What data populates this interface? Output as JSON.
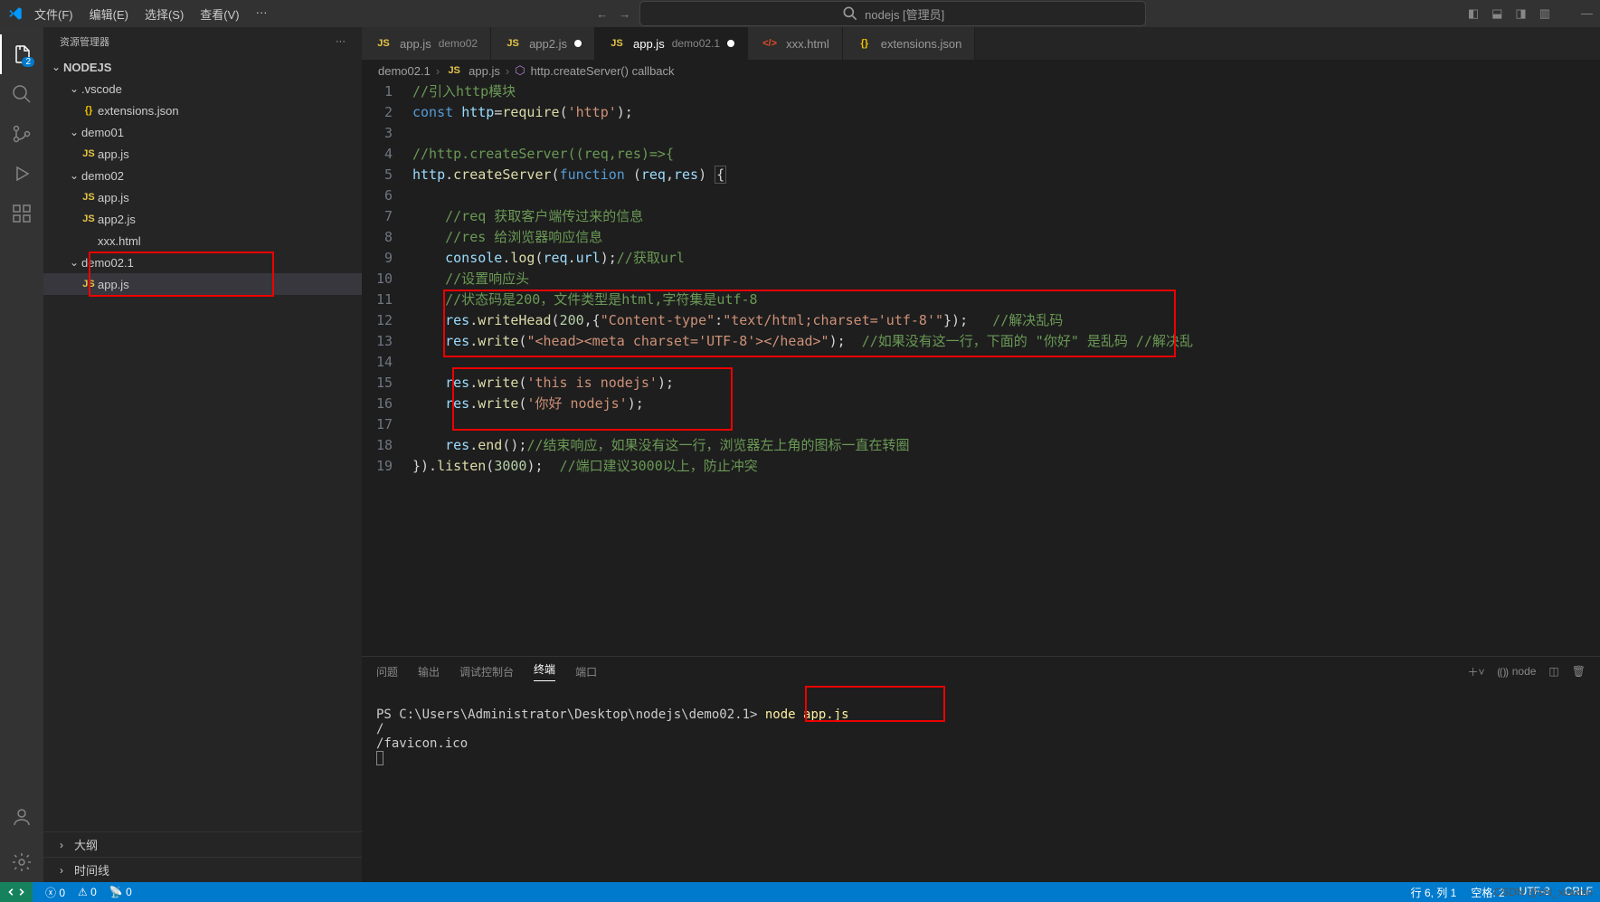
{
  "menu": [
    "文件(F)",
    "编辑(E)",
    "选择(S)",
    "查看(V)",
    "···"
  ],
  "window_title": "nodejs [管理员]",
  "activity_badge": "2",
  "explorer": {
    "title": "资源管理器",
    "root": "NODEJS",
    "items": [
      {
        "kind": "folder",
        "name": ".vscode",
        "depth": 1,
        "open": true
      },
      {
        "kind": "file",
        "name": "extensions.json",
        "depth": 2,
        "icon": "json"
      },
      {
        "kind": "folder",
        "name": "demo01",
        "depth": 1,
        "open": true
      },
      {
        "kind": "file",
        "name": "app.js",
        "depth": 2,
        "icon": "js"
      },
      {
        "kind": "folder",
        "name": "demo02",
        "depth": 1,
        "open": true
      },
      {
        "kind": "file",
        "name": "app.js",
        "depth": 2,
        "icon": "js"
      },
      {
        "kind": "file",
        "name": "app2.js",
        "depth": 2,
        "icon": "js"
      },
      {
        "kind": "file",
        "name": "xxx.html",
        "depth": 2,
        "icon": "html"
      },
      {
        "kind": "folder",
        "name": "demo02.1",
        "depth": 1,
        "open": true,
        "hl": true
      },
      {
        "kind": "file",
        "name": "app.js",
        "depth": 2,
        "icon": "js",
        "selected": true,
        "hl": true
      }
    ],
    "outline": "大纲",
    "timeline": "时间线"
  },
  "tabs": [
    {
      "icon": "js",
      "name": "app.js",
      "suffix": "demo02"
    },
    {
      "icon": "js",
      "name": "app2.js",
      "dirty": true
    },
    {
      "icon": "js",
      "name": "app.js",
      "suffix": "demo02.1",
      "active": true,
      "dirty": true
    },
    {
      "icon": "html",
      "name": "xxx.html"
    },
    {
      "icon": "json",
      "name": "extensions.json"
    }
  ],
  "breadcrumb": {
    "folder": "demo02.1",
    "file": "app.js",
    "symbol": "http.createServer() callback"
  },
  "code_lines": [
    {
      "n": 1,
      "html": "<span class='tok-comment'>//引入http模块</span>"
    },
    {
      "n": 2,
      "html": "<span class='tok-keyword'>const</span> <span class='tok-var'>http</span>=<span class='tok-func'>require</span>(<span class='tok-string'>'http'</span>);"
    },
    {
      "n": 3,
      "html": ""
    },
    {
      "n": 4,
      "html": "<span class='tok-comment'>//http.createServer((req,res)=&gt;{</span>"
    },
    {
      "n": 5,
      "html": "<span class='tok-var'>http</span>.<span class='tok-func'>createServer</span>(<span class='tok-keyword'>function</span> (<span class='tok-var'>req</span>,<span class='tok-var'>res</span>) <span style='border:1px solid #555;padding:0 1px'>{</span>"
    },
    {
      "n": 6,
      "html": ""
    },
    {
      "n": 7,
      "html": "    <span class='tok-comment'>//req 获取客户端传过来的信息</span>"
    },
    {
      "n": 8,
      "html": "    <span class='tok-comment'>//res 给浏览器响应信息</span>"
    },
    {
      "n": 9,
      "html": "    <span class='tok-var'>console</span>.<span class='tok-func'>log</span>(<span class='tok-var'>req</span>.<span class='tok-var'>url</span>);<span class='tok-comment'>//获取url</span>"
    },
    {
      "n": 10,
      "html": "    <span class='tok-comment'>//设置响应头</span>"
    },
    {
      "n": 11,
      "html": "    <span class='tok-comment'>//状态码是200，文件类型是html,字符集是utf-8</span>"
    },
    {
      "n": 12,
      "html": "    <span class='tok-var'>res</span>.<span class='tok-func'>writeHead</span>(<span class='tok-num'>200</span>,{<span class='tok-string'>\"Content-type\"</span>:<span class='tok-string'>\"text/html;charset='utf-8'\"</span>});   <span class='tok-comment'>//解决乱码</span>"
    },
    {
      "n": 13,
      "html": "    <span class='tok-var'>res</span>.<span class='tok-func'>write</span>(<span class='tok-string'>\"&lt;head&gt;&lt;meta charset='UTF-8'&gt;&lt;/head&gt;\"</span>);  <span class='tok-comment'>//如果没有这一行，下面的 \"你好\" 是乱码 //解决乱</span>"
    },
    {
      "n": 14,
      "html": ""
    },
    {
      "n": 15,
      "html": "    <span class='tok-var'>res</span>.<span class='tok-func'>write</span>(<span class='tok-string'>'this is nodejs'</span>);"
    },
    {
      "n": 16,
      "html": "    <span class='tok-var'>res</span>.<span class='tok-func'>write</span>(<span class='tok-string'>'你好 nodejs'</span>);"
    },
    {
      "n": 17,
      "html": ""
    },
    {
      "n": 18,
      "html": "    <span class='tok-var'>res</span>.<span class='tok-func'>end</span>();<span class='tok-comment'>//结束响应，如果没有这一行，浏览器左上角的图标一直在转圈</span>"
    },
    {
      "n": 19,
      "html": "}).<span class='tok-func'>listen</span>(<span class='tok-num'>3000</span>);  <span class='tok-comment'>//端口建议3000以上，防止冲突</span>"
    }
  ],
  "panel": {
    "tabs": [
      "问题",
      "输出",
      "调试控制台",
      "终端",
      "端口"
    ],
    "active": "终端",
    "shell_label": "node",
    "prompt": "PS C:\\Users\\Administrator\\Desktop\\nodejs\\demo02.1>",
    "command": "node app.js",
    "output": [
      "/",
      "/favicon.ico"
    ]
  },
  "status": {
    "errors": "0",
    "warnings": "0",
    "ports": "0",
    "pos": "行 6, 列 1",
    "spaces": "空格: 2",
    "encoding": "UTF-8",
    "eol": "CRLF"
  },
  "watermark": "CSDN @shi_xiaobin"
}
